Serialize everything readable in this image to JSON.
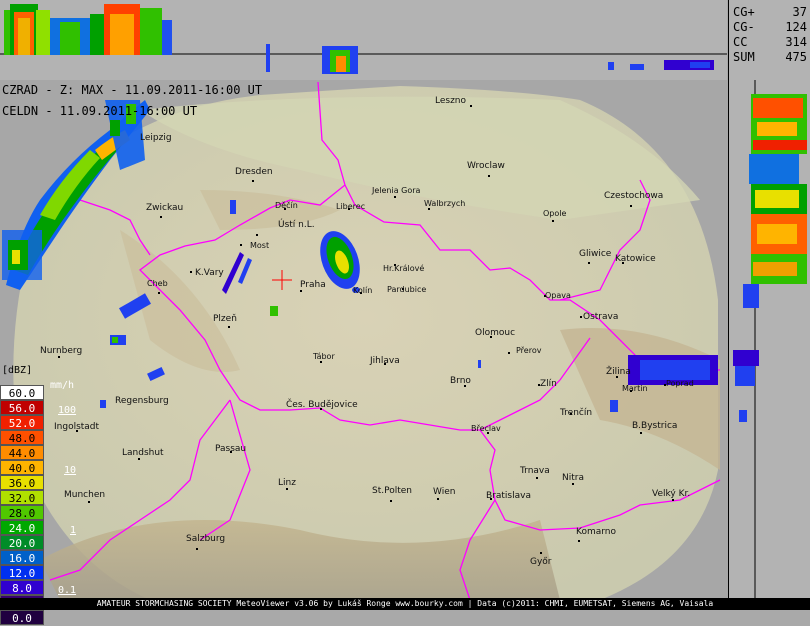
{
  "header": {
    "radar_title": "CZRAD - Z: MAX - 11.09.2011-16:00 UT",
    "lightning_title": "CELDN - 11.09.2011-16:00 UT"
  },
  "stats": [
    {
      "label": "CG+",
      "value": "37"
    },
    {
      "label": "CG-",
      "value": "124"
    },
    {
      "label": "CC",
      "value": "314"
    },
    {
      "label": "SUM",
      "value": "475"
    }
  ],
  "cities": [
    {
      "name": "Leszno"
    },
    {
      "name": "Leipzig"
    },
    {
      "name": "Dresden"
    },
    {
      "name": "Wroclaw"
    },
    {
      "name": "Jelenia Gora"
    },
    {
      "name": "Walbrzych"
    },
    {
      "name": "Czestochowa"
    },
    {
      "name": "Zwickau"
    },
    {
      "name": "Děčín"
    },
    {
      "name": "Liberec"
    },
    {
      "name": "Opole"
    },
    {
      "name": "Ústí n.L."
    },
    {
      "name": "Most"
    },
    {
      "name": "Hr.Králové"
    },
    {
      "name": "Gliwice"
    },
    {
      "name": "Katowice"
    },
    {
      "name": "K.Vary"
    },
    {
      "name": "Praha"
    },
    {
      "name": "Pardubice"
    },
    {
      "name": "Cheb"
    },
    {
      "name": "Kolín"
    },
    {
      "name": "Opava"
    },
    {
      "name": "Ostrava"
    },
    {
      "name": "Plzeň"
    },
    {
      "name": "Olomouc"
    },
    {
      "name": "Přerov"
    },
    {
      "name": "Nurnberg"
    },
    {
      "name": "Tábor"
    },
    {
      "name": "Jihlava"
    },
    {
      "name": "Žilina"
    },
    {
      "name": "Brno"
    },
    {
      "name": "Zlín"
    },
    {
      "name": "Martin"
    },
    {
      "name": "Poprad"
    },
    {
      "name": "Regensburg"
    },
    {
      "name": "Čes. Budějovice"
    },
    {
      "name": "Trenčín"
    },
    {
      "name": "Ingolstadt"
    },
    {
      "name": "Břeclav"
    },
    {
      "name": "B.Bystrica"
    },
    {
      "name": "Passau"
    },
    {
      "name": "Landshut"
    },
    {
      "name": "Trnava"
    },
    {
      "name": "Nitra"
    },
    {
      "name": "Linz"
    },
    {
      "name": "St.Polten"
    },
    {
      "name": "Wien"
    },
    {
      "name": "Munchen"
    },
    {
      "name": "Bratislava"
    },
    {
      "name": "Velký Kr."
    },
    {
      "name": "Komarno"
    },
    {
      "name": "Salzburg"
    },
    {
      "name": "Győr"
    }
  ],
  "legend": {
    "header": "[dBZ]",
    "rain_header": "mm/h",
    "rows": [
      {
        "label": "60.0",
        "color": "#ffffff"
      },
      {
        "label": "56.0",
        "color": "#c00000"
      },
      {
        "label": "52.0",
        "color": "#f02000"
      },
      {
        "label": "48.0",
        "color": "#ff5000"
      },
      {
        "label": "44.0",
        "color": "#ff8c00"
      },
      {
        "label": "40.0",
        "color": "#ffb400"
      },
      {
        "label": "36.0",
        "color": "#e8e000"
      },
      {
        "label": "32.0",
        "color": "#b0e000"
      },
      {
        "label": "28.0",
        "color": "#50c800"
      },
      {
        "label": "24.0",
        "color": "#00a800"
      },
      {
        "label": "20.0",
        "color": "#008c28"
      },
      {
        "label": "16.0",
        "color": "#0060c8"
      },
      {
        "label": "12.0",
        "color": "#0030f0"
      },
      {
        "label": "8.0",
        "color": "#3000d0"
      },
      {
        "label": "4.0",
        "color": "#380070"
      },
      {
        "label": "0.0",
        "color": "#200040"
      }
    ],
    "rain_labels": [
      "100",
      "10",
      "1",
      "0.1"
    ]
  },
  "footer": {
    "text": "AMATEUR STORMCHASING SOCIETY MeteoViewer v3.06 by Lukáš Ronge www.bourky.com | Data (c)2011: CHMI, EUMETSAT, Siemens AG, Vaisala"
  }
}
